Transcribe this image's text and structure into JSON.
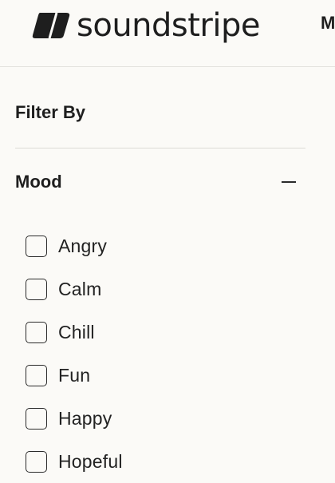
{
  "header": {
    "logo_text": "soundstripe",
    "nav_peek": "M"
  },
  "filter": {
    "title": "Filter By",
    "section": {
      "title": "Mood",
      "toggle_icon": "minus-icon",
      "expanded": true,
      "options": [
        {
          "label": "Angry",
          "checked": false
        },
        {
          "label": "Calm",
          "checked": false
        },
        {
          "label": "Chill",
          "checked": false
        },
        {
          "label": "Fun",
          "checked": false
        },
        {
          "label": "Happy",
          "checked": false
        },
        {
          "label": "Hopeful",
          "checked": false
        }
      ]
    }
  },
  "colors": {
    "background": "#fbfaf7",
    "text": "#1e1e1e",
    "divider": "#dcdbd7"
  }
}
